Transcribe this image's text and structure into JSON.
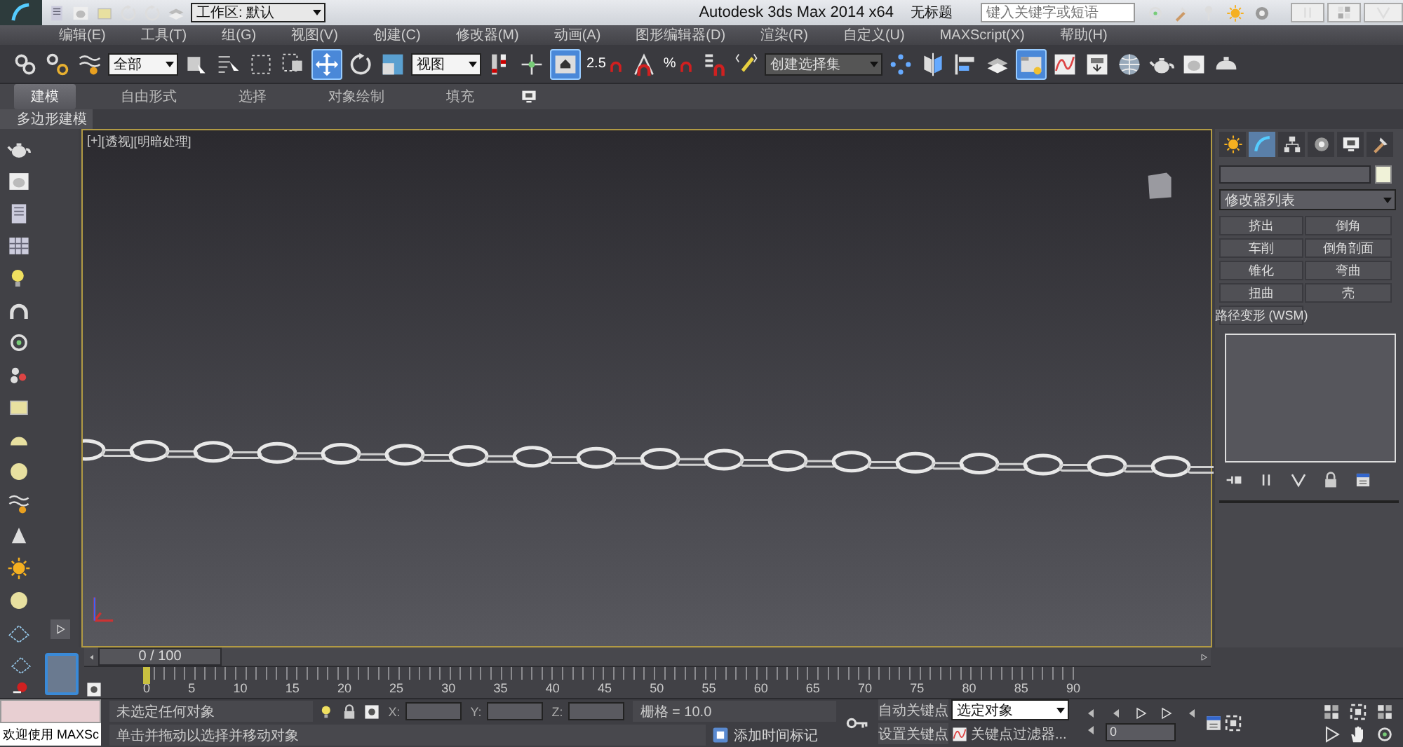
{
  "title_bar": {
    "workspace": "工作区: 默认",
    "app_title": "Autodesk 3ds Max  2014 x64",
    "document": "无标题",
    "search": {
      "placeholder": "键入关键字或短语"
    }
  },
  "menu_bar": [
    "编辑(E)",
    "工具(T)",
    "组(G)",
    "视图(V)",
    "创建(C)",
    "修改器(M)",
    "动画(A)",
    "图形编辑器(D)",
    "渲染(R)",
    "自定义(U)",
    "MAXScript(X)",
    "帮助(H)"
  ],
  "main_toolbar": [
    {
      "kind": "tool",
      "selected": false
    },
    {
      "kind": "tool",
      "selected": false
    },
    {
      "kind": "tool",
      "selected": false
    },
    {
      "kind": "dropdown",
      "value": "全部"
    },
    {
      "kind": "tool",
      "selected": false
    },
    {
      "kind": "tool",
      "selected": false
    },
    {
      "kind": "tool",
      "selected": false
    },
    {
      "kind": "tool",
      "selected": false
    },
    {
      "kind": "tool",
      "selected": true
    },
    {
      "kind": "tool",
      "selected": false
    },
    {
      "kind": "tool",
      "selected": false
    },
    {
      "kind": "dropdown",
      "value": "视图"
    },
    {
      "kind": "tool",
      "selected": false
    },
    {
      "kind": "tool",
      "selected": false
    },
    {
      "kind": "tool",
      "selected": true
    },
    {
      "kind": "snap",
      "selected": false,
      "text": "2.5"
    },
    {
      "kind": "tool",
      "selected": false
    },
    {
      "kind": "snap",
      "selected": false,
      "text": "%"
    },
    {
      "kind": "tool",
      "selected": false
    },
    {
      "kind": "tool",
      "selected": false
    },
    {
      "kind": "dropdown",
      "value": "创建选择集"
    },
    {
      "kind": "tool",
      "selected": false
    },
    {
      "kind": "tool",
      "selected": false
    },
    {
      "kind": "tool",
      "selected": false
    },
    {
      "kind": "tool",
      "selected": false
    },
    {
      "kind": "tool",
      "selected": true
    },
    {
      "kind": "tool",
      "selected": false
    },
    {
      "kind": "tool",
      "selected": false
    },
    {
      "kind": "tool",
      "selected": false
    },
    {
      "kind": "tool",
      "selected": false
    },
    {
      "kind": "tool",
      "selected": false
    },
    {
      "kind": "tool",
      "selected": false
    }
  ],
  "ribbon": {
    "tabs": [
      {
        "label": "建模",
        "selected": true
      },
      {
        "label": "自由形式",
        "selected": false
      },
      {
        "label": "选择",
        "selected": false
      },
      {
        "label": "对象绘制",
        "selected": false
      },
      {
        "label": "填充",
        "selected": false
      }
    ],
    "panel": "多边形建模"
  },
  "viewport": {
    "labels": [
      "[+]",
      "[透视]",
      "[明暗处理]"
    ]
  },
  "command_panel": {
    "tabs": [
      {
        "selected": false
      },
      {
        "selected": true
      },
      {
        "selected": false
      },
      {
        "selected": false
      },
      {
        "selected": false
      },
      {
        "selected": false
      }
    ],
    "modifier_list": "修改器列表",
    "modifier_buttons": [
      "挤出",
      "倒角",
      "车削",
      "倒角剖面",
      "锥化",
      "弯曲",
      "扭曲",
      "壳",
      "路径变形 (WSM)"
    ]
  },
  "time_slider": {
    "label": "0 / 100",
    "level": 0
  },
  "track_bar": {
    "ticks": [
      "0",
      "5",
      "10",
      "15",
      "20",
      "25",
      "30",
      "35",
      "40",
      "45",
      "50",
      "55",
      "60",
      "65",
      "70",
      "75",
      "80",
      "85",
      "90"
    ]
  },
  "status_bar": {
    "welcome": "欢迎使用 MAXSc",
    "selection_status": "未选定任何对象",
    "prompt": "单击并拖动以选择并移动对象",
    "coords": [
      {
        "label": "X:"
      },
      {
        "label": "Y:"
      },
      {
        "label": "Z:"
      }
    ],
    "grid": "栅格 = 10.0",
    "add_time_tag": "添加时间标记",
    "auto_key": "自动关键点",
    "set_key": "设置关键点",
    "key_mode": "选定对象",
    "key_filters": "关键点过滤器...",
    "current_frame": "0"
  }
}
